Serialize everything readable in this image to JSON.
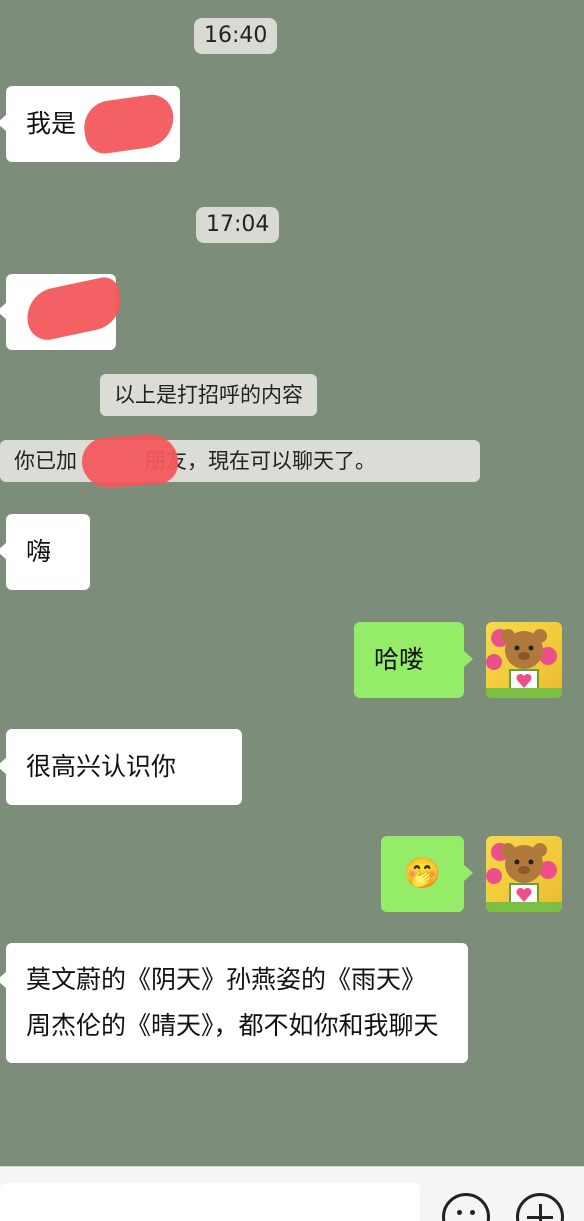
{
  "chat": {
    "time1": "16:40",
    "msg_intro": "我是",
    "time2": "17:04",
    "system_greeting_note": "以上是打招呼的内容",
    "system_added_prefix": "你已加",
    "system_added_suffix": "朋友，現在可以聊天了。",
    "msg_hi": "嗨",
    "msg_hello": "哈喽",
    "msg_nice": "很高兴认识你",
    "msg_emoji": "🤭",
    "msg_long": "莫文蔚的《阴天》孙燕姿的《雨天》周杰伦的《晴天》，都不如你和我聊天"
  },
  "colors": {
    "background": "#7c8e7a",
    "bubble_incoming": "#ffffff",
    "bubble_outgoing": "#95ec69",
    "redaction": "#f3585d"
  },
  "icons": {
    "emoji_button": "smiley-icon",
    "plus_button": "plus-icon"
  }
}
